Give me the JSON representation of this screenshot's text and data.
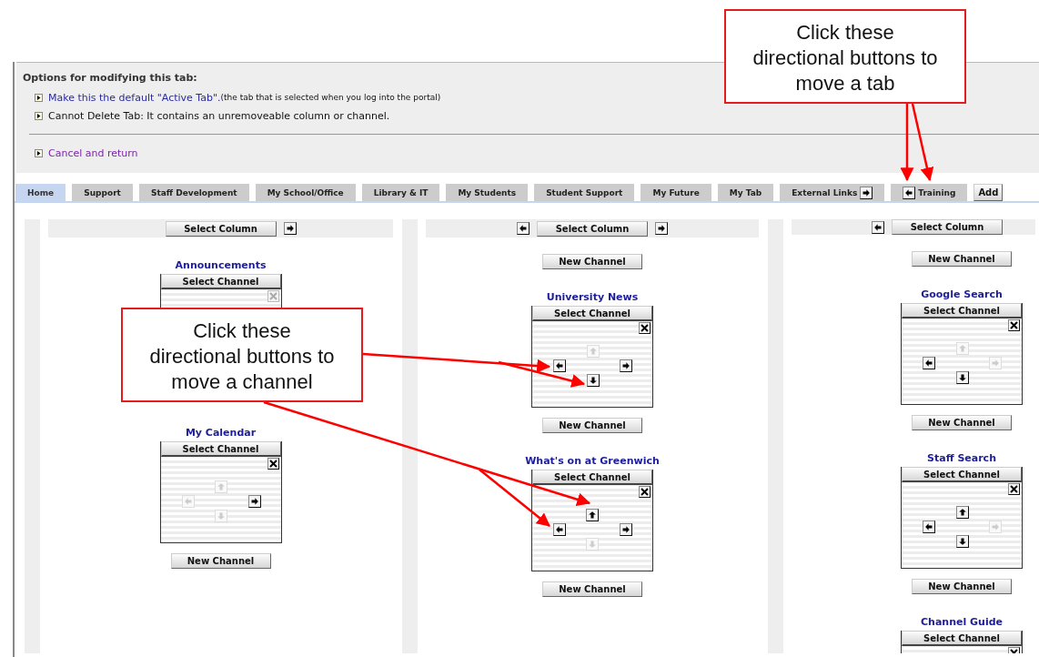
{
  "options": {
    "heading": "Options for modifying this tab:",
    "items": [
      {
        "kind": "link",
        "text": "Make this the default \"Active Tab\".",
        "note": "(the tab that is selected when you log into the portal)"
      },
      {
        "kind": "text",
        "text": "Cannot Delete Tab: It contains an unremoveable column or channel."
      }
    ],
    "cancel": "Cancel and return"
  },
  "tabs": [
    {
      "label": "Home",
      "selected": true
    },
    {
      "label": "Support",
      "selected": false
    },
    {
      "label": "Staff Development",
      "selected": false
    },
    {
      "label": "My School/Office",
      "selected": false
    },
    {
      "label": "Library & IT",
      "selected": false
    },
    {
      "label": "My Students",
      "selected": false
    },
    {
      "label": "Student Support",
      "selected": false
    },
    {
      "label": "My Future",
      "selected": false
    },
    {
      "label": "My Tab",
      "selected": false
    },
    {
      "label": "External Links",
      "selected": false,
      "right_arrow": true
    },
    {
      "label": "Training",
      "selected": false,
      "left_arrow": true
    }
  ],
  "add_button": "Add",
  "columns": [
    {
      "right_button": true,
      "select_label": "Select Column",
      "items": [
        {
          "kind": "channel",
          "title": "Announcements",
          "select_label": "Select Channel",
          "close_enabled": false
        },
        {
          "kind": "channel",
          "title": "My Calendar",
          "select_label": "Select Channel",
          "close_enabled": true,
          "moves": {
            "up": false,
            "left": false,
            "right": true,
            "down": false
          }
        },
        {
          "kind": "new_channel",
          "label": "New Channel"
        }
      ]
    },
    {
      "left_button": true,
      "right_button": true,
      "select_label": "Select Column",
      "items": [
        {
          "kind": "new_channel",
          "label": "New Channel"
        },
        {
          "kind": "channel",
          "title": "University News",
          "select_label": "Select Channel",
          "close_enabled": true,
          "moves": {
            "up": false,
            "left": true,
            "right": true,
            "down": true
          }
        },
        {
          "kind": "new_channel",
          "label": "New Channel"
        },
        {
          "kind": "channel",
          "title": "What's on at Greenwich",
          "select_label": "Select Channel",
          "close_enabled": true,
          "moves": {
            "up": true,
            "left": true,
            "right": true,
            "down": false
          }
        },
        {
          "kind": "new_channel",
          "label": "New Channel"
        }
      ]
    },
    {
      "left_button": true,
      "select_label": "Select Column",
      "items": [
        {
          "kind": "new_channel",
          "label": "New Channel"
        },
        {
          "kind": "channel",
          "title": "Google Search",
          "select_label": "Select Channel",
          "close_enabled": true,
          "moves": {
            "up": false,
            "left": true,
            "right": false,
            "down": true
          }
        },
        {
          "kind": "new_channel",
          "label": "New Channel"
        },
        {
          "kind": "channel",
          "title": "Staff Search",
          "select_label": "Select Channel",
          "close_enabled": true,
          "moves": {
            "up": true,
            "left": true,
            "right": false,
            "down": true
          }
        },
        {
          "kind": "new_channel",
          "label": "New Channel"
        },
        {
          "kind": "channel",
          "title": "Channel Guide",
          "select_label": "Select Channel",
          "close_enabled": true
        }
      ]
    }
  ],
  "callouts": [
    {
      "text": "Click these\ndirectional buttons to\nmove a tab"
    },
    {
      "text": "Click these\ndirectional buttons to\nmove a channel"
    }
  ]
}
